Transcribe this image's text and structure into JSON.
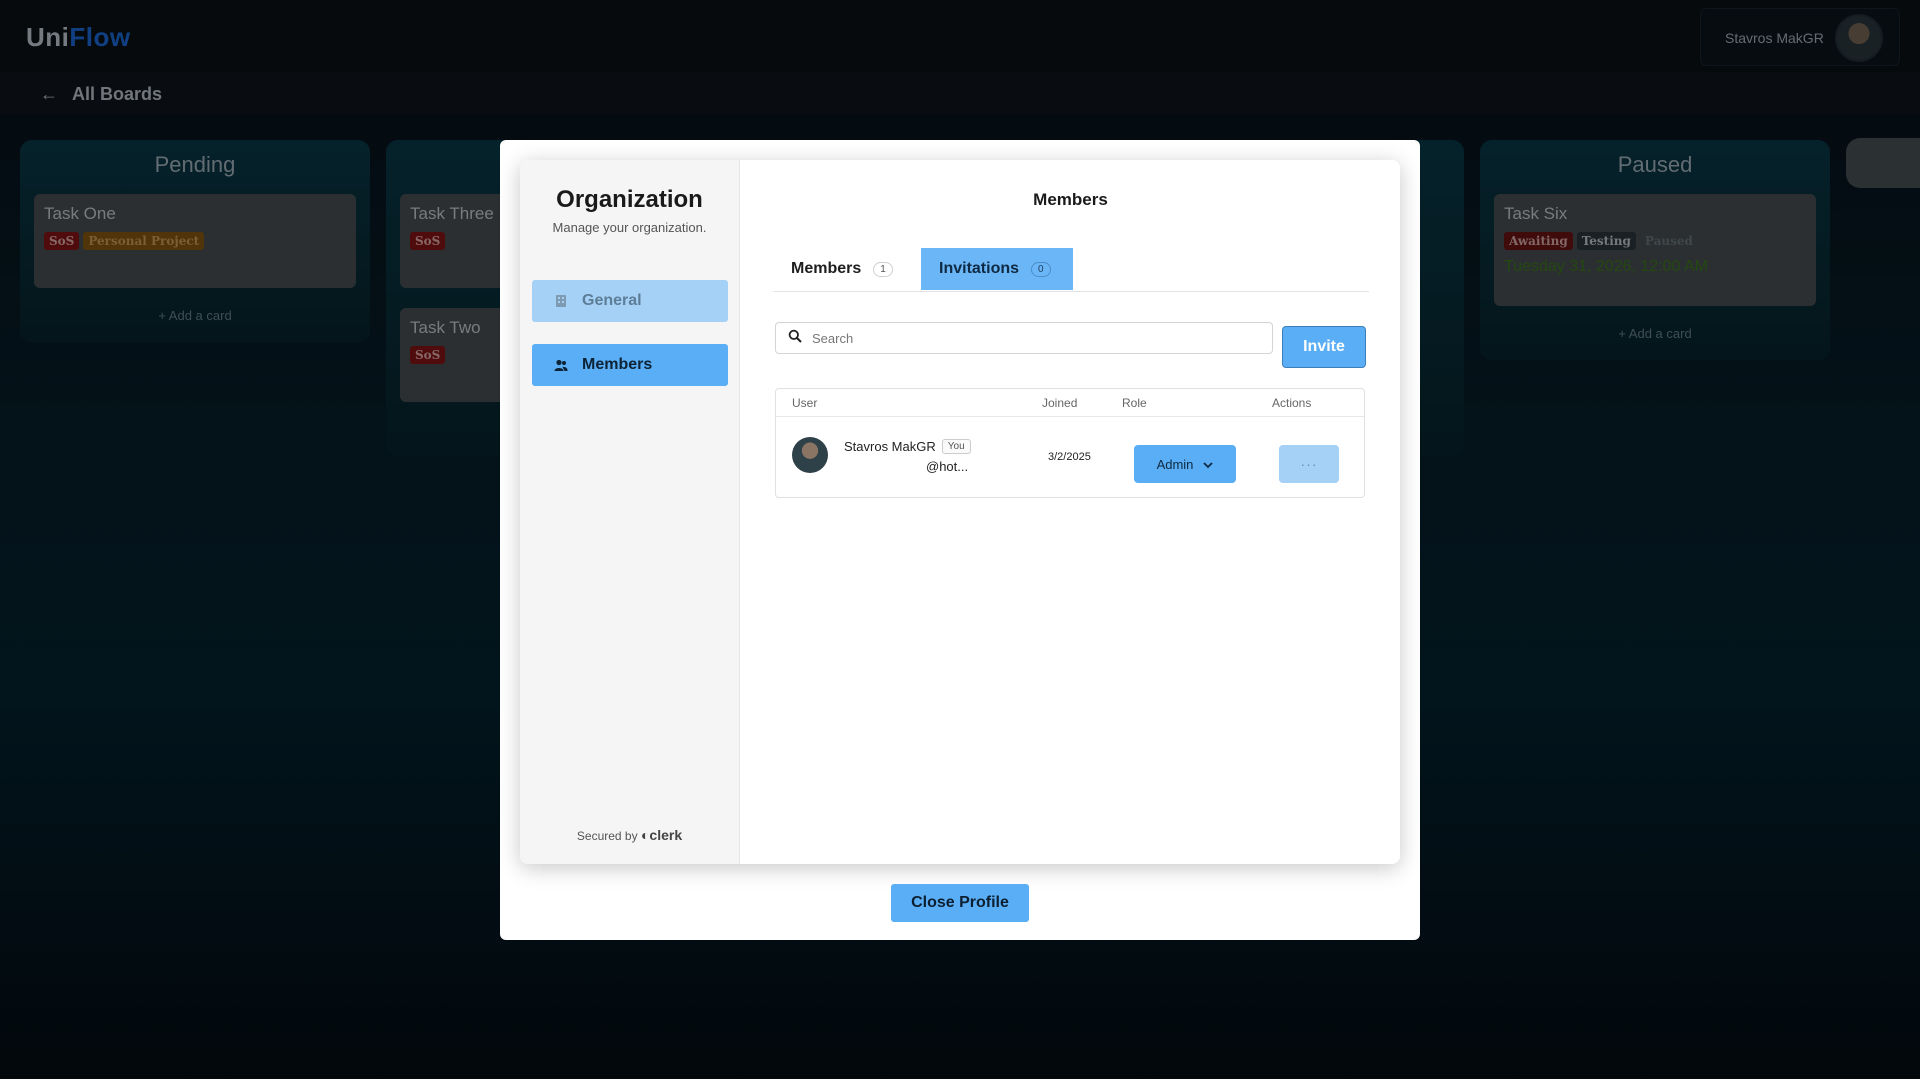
{
  "app": {
    "logo_part1": "Uni",
    "logo_part2": "Flow",
    "user_name": "Stavros MakGR"
  },
  "subbar": {
    "back_label": "All Boards"
  },
  "board": {
    "columns": [
      {
        "title": "Pending",
        "add_label": "+ Add a card",
        "cards": [
          {
            "title": "Task One",
            "tags": [
              "SoS",
              "Personal Project"
            ]
          }
        ]
      },
      {
        "title": "",
        "add_label": "",
        "cards": [
          {
            "title": "Task Three",
            "tags": [
              "SoS"
            ]
          },
          {
            "title": "Task Two",
            "tags": [
              "SoS"
            ]
          }
        ]
      },
      {
        "title": "Paused",
        "add_label": "+ Add a card",
        "cards": [
          {
            "title": "Task Six",
            "tags": [
              "Awaiting",
              "Testing",
              "Paused"
            ],
            "date": "Tuesday 31, 2026, 12:00 AM"
          }
        ]
      }
    ]
  },
  "org": {
    "title": "Organization",
    "subtitle": "Manage your organization.",
    "nav": [
      {
        "label": "General",
        "icon": "building-icon"
      },
      {
        "label": "Members",
        "icon": "users-icon"
      }
    ],
    "secured_by": "Secured by",
    "clerk": "clerk"
  },
  "members_page": {
    "heading": "Members",
    "tabs": [
      {
        "label": "Members",
        "count": "1"
      },
      {
        "label": "Invitations",
        "count": "0"
      }
    ],
    "search_placeholder": "Search",
    "invite_label": "Invite",
    "columns": [
      "User",
      "Joined",
      "Role",
      "Actions"
    ],
    "rows": [
      {
        "name": "Stavros MakGR",
        "badge": "You",
        "email": "@hot...",
        "joined": "3/2/2025",
        "role": "Admin",
        "actions": "···"
      }
    ]
  },
  "close_label": "Close Profile",
  "colors": {
    "accent": "#5aaef6",
    "accent_light": "#a5d1f7",
    "brand_flow": "#1c6fe0"
  }
}
